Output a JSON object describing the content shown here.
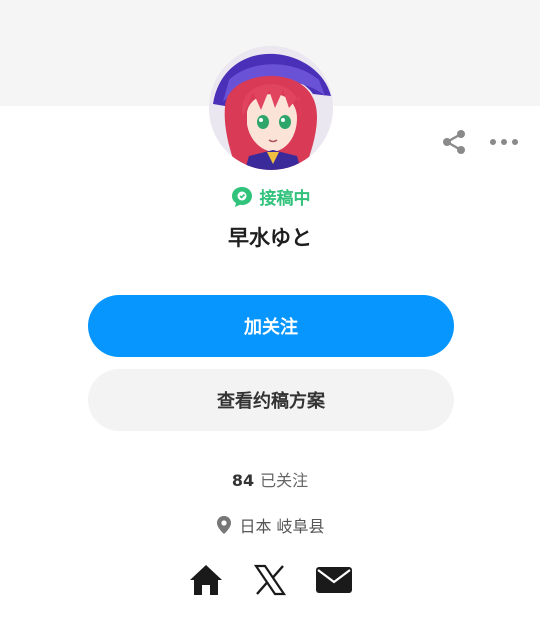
{
  "profile": {
    "status_label": "接稿中",
    "name": "早水ゆと",
    "avatar_icon": "anime-character-avatar"
  },
  "actions": {
    "follow_label": "加关注",
    "plans_label": "查看约稿方案",
    "share_icon": "share-icon",
    "more_icon": "more-icon"
  },
  "stats": {
    "following_count": "84",
    "following_label": "已关注"
  },
  "location": {
    "text": "日本 岐阜县"
  },
  "social": {
    "icons": [
      "home-icon",
      "x-icon",
      "mail-icon"
    ]
  },
  "colors": {
    "accent": "#0796fe",
    "status_green": "#31c27c"
  }
}
